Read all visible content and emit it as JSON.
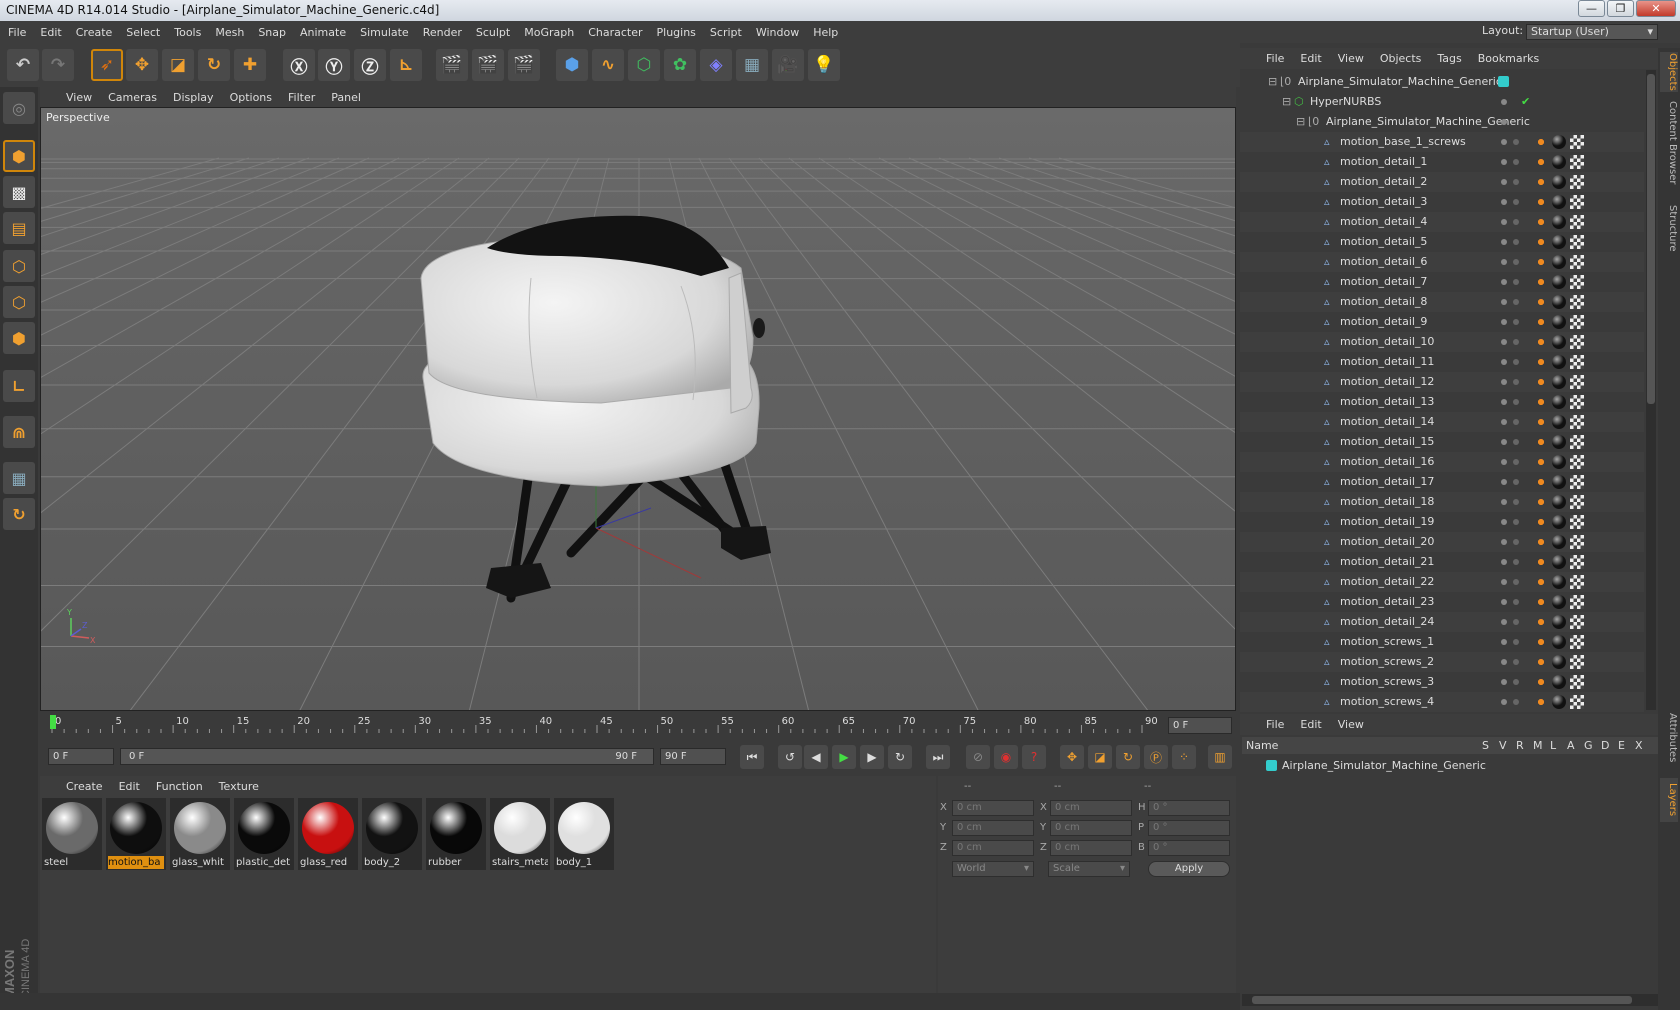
{
  "title": "CINEMA 4D R14.014 Studio - [Airplane_Simulator_Machine_Generic.c4d]",
  "window_buttons": {
    "minimize": "—",
    "maximize": "❐",
    "close": "✕"
  },
  "menu": [
    "File",
    "Edit",
    "Create",
    "Select",
    "Tools",
    "Mesh",
    "Snap",
    "Animate",
    "Simulate",
    "Render",
    "Sculpt",
    "MoGraph",
    "Character",
    "Plugins",
    "Script",
    "Window",
    "Help"
  ],
  "layout": {
    "label": "Layout:",
    "value": "Startup (User)"
  },
  "viewport": {
    "menu": [
      "View",
      "Cameras",
      "Display",
      "Options",
      "Filter",
      "Panel"
    ],
    "label": "Perspective",
    "axis": {
      "x": "X",
      "y": "Y",
      "z": "Z"
    }
  },
  "timeline": {
    "ticks": [
      "0",
      "5",
      "10",
      "15",
      "20",
      "25",
      "30",
      "35",
      "40",
      "45",
      "50",
      "55",
      "60",
      "65",
      "70",
      "75",
      "80",
      "85",
      "90"
    ],
    "current_frame": "0 F",
    "start_field": "0 F",
    "slider_left": "0 F",
    "slider_right": "90 F",
    "end_field": "90 F"
  },
  "materials": {
    "menu": [
      "Create",
      "Edit",
      "Function",
      "Texture"
    ],
    "items": [
      {
        "name": "steel",
        "selected": false,
        "color": "#6a6a6a"
      },
      {
        "name": "motion_ba",
        "selected": true,
        "color": "#0e0e0e"
      },
      {
        "name": "glass_whit",
        "selected": false,
        "color": "#8a8a8a"
      },
      {
        "name": "plastic_det",
        "selected": false,
        "color": "#0a0a0a"
      },
      {
        "name": "glass_red",
        "selected": false,
        "color": "#c81010"
      },
      {
        "name": "body_2",
        "selected": false,
        "color": "#121212"
      },
      {
        "name": "rubber",
        "selected": false,
        "color": "#080808"
      },
      {
        "name": "stairs_meta",
        "selected": false,
        "color": "#dcdcdc"
      },
      {
        "name": "body_1",
        "selected": false,
        "color": "#e0e0e0"
      }
    ]
  },
  "attributes": {
    "header": [
      "--",
      "--",
      "--"
    ],
    "rows": [
      {
        "l1": "X",
        "v1": "0 cm",
        "l2": "X",
        "v2": "0 cm",
        "l3": "H",
        "v3": "0 °"
      },
      {
        "l1": "Y",
        "v1": "0 cm",
        "l2": "Y",
        "v2": "0 cm",
        "l3": "P",
        "v3": "0 °"
      },
      {
        "l1": "Z",
        "v1": "0 cm",
        "l2": "Z",
        "v2": "0 cm",
        "l3": "B",
        "v3": "0 °"
      }
    ],
    "coord_system": "World",
    "mode": "Scale",
    "apply": "Apply"
  },
  "objects": {
    "menu": [
      "File",
      "Edit",
      "View",
      "Objects",
      "Tags",
      "Bookmarks"
    ],
    "root": "Airplane_Simulator_Machine_Generic",
    "hypernurbs": "HyperNURBS",
    "group": "Airplane_Simulator_Machine_Generic",
    "checkmark": "✔",
    "children": [
      "motion_base_1_screws",
      "motion_detail_1",
      "motion_detail_2",
      "motion_detail_3",
      "motion_detail_4",
      "motion_detail_5",
      "motion_detail_6",
      "motion_detail_7",
      "motion_detail_8",
      "motion_detail_9",
      "motion_detail_10",
      "motion_detail_11",
      "motion_detail_12",
      "motion_detail_13",
      "motion_detail_14",
      "motion_detail_15",
      "motion_detail_16",
      "motion_detail_17",
      "motion_detail_18",
      "motion_detail_19",
      "motion_detail_20",
      "motion_detail_21",
      "motion_detail_22",
      "motion_detail_23",
      "motion_detail_24",
      "motion_screws_1",
      "motion_screws_2",
      "motion_screws_3",
      "motion_screws_4"
    ]
  },
  "layers": {
    "menu": [
      "File",
      "Edit",
      "View"
    ],
    "columns": [
      "Name",
      "S",
      "V",
      "R",
      "M",
      "L",
      "A",
      "G",
      "D",
      "E",
      "X"
    ],
    "rows": [
      "Airplane_Simulator_Machine_Generic"
    ]
  },
  "side_tabs": [
    "Objects",
    "Content Browser",
    "Structure",
    "Attributes",
    "Layers"
  ],
  "brand": {
    "maker": "MAXON",
    "product": "CINEMA 4D"
  },
  "colors": {
    "accent": "#d0860a",
    "layer_cyan": "#33cccc",
    "hypernurbs_green": "#44bb44"
  }
}
